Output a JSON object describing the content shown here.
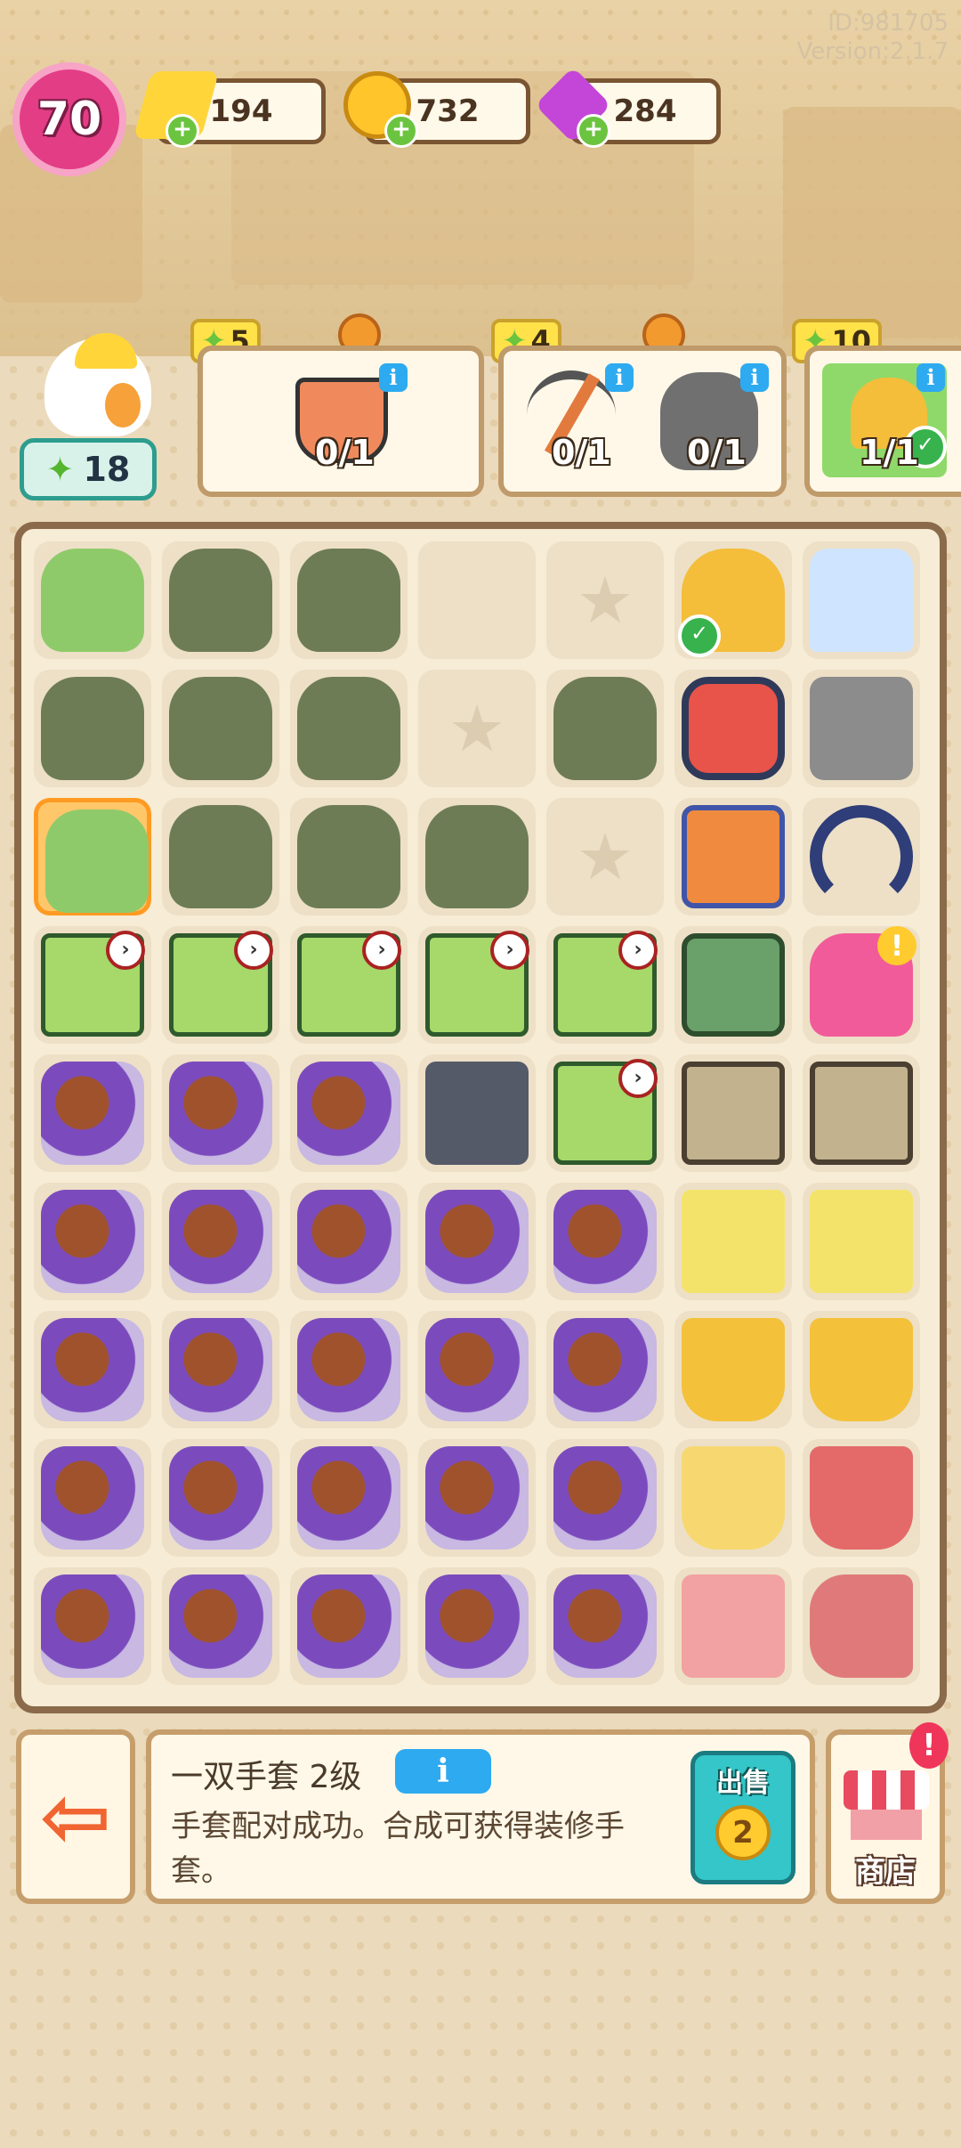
{
  "meta": {
    "id_text": "ID:981705",
    "version_text": "Version:2.1.7"
  },
  "top_bar": {
    "level": "70",
    "energy": "194",
    "coins": "732",
    "gems": "284"
  },
  "clover_count": "18",
  "orders": [
    {
      "reward": "5",
      "progress": "0/1",
      "items": [
        "bucket"
      ]
    },
    {
      "reward": "4",
      "progress_1": "0/1",
      "progress_2": "0/1",
      "items": [
        "pickaxe",
        "sack"
      ]
    },
    {
      "reward": "10",
      "progress": "1/1",
      "items": [
        "tiara"
      ],
      "complete": true
    }
  ],
  "grid_legend": "Merge board 7 columns x 9 rows",
  "bottom": {
    "item_title": "一双手套 2级",
    "info_label": "i",
    "description": "手套配对成功。合成可获得装修手套。",
    "sell_label": "出售",
    "sell_price": "2",
    "shop_label": "商店",
    "shop_alert": "!"
  },
  "colors": {
    "accent": "#e33d86",
    "board_border": "#8a6a4a",
    "sell": "#34c6c8"
  }
}
